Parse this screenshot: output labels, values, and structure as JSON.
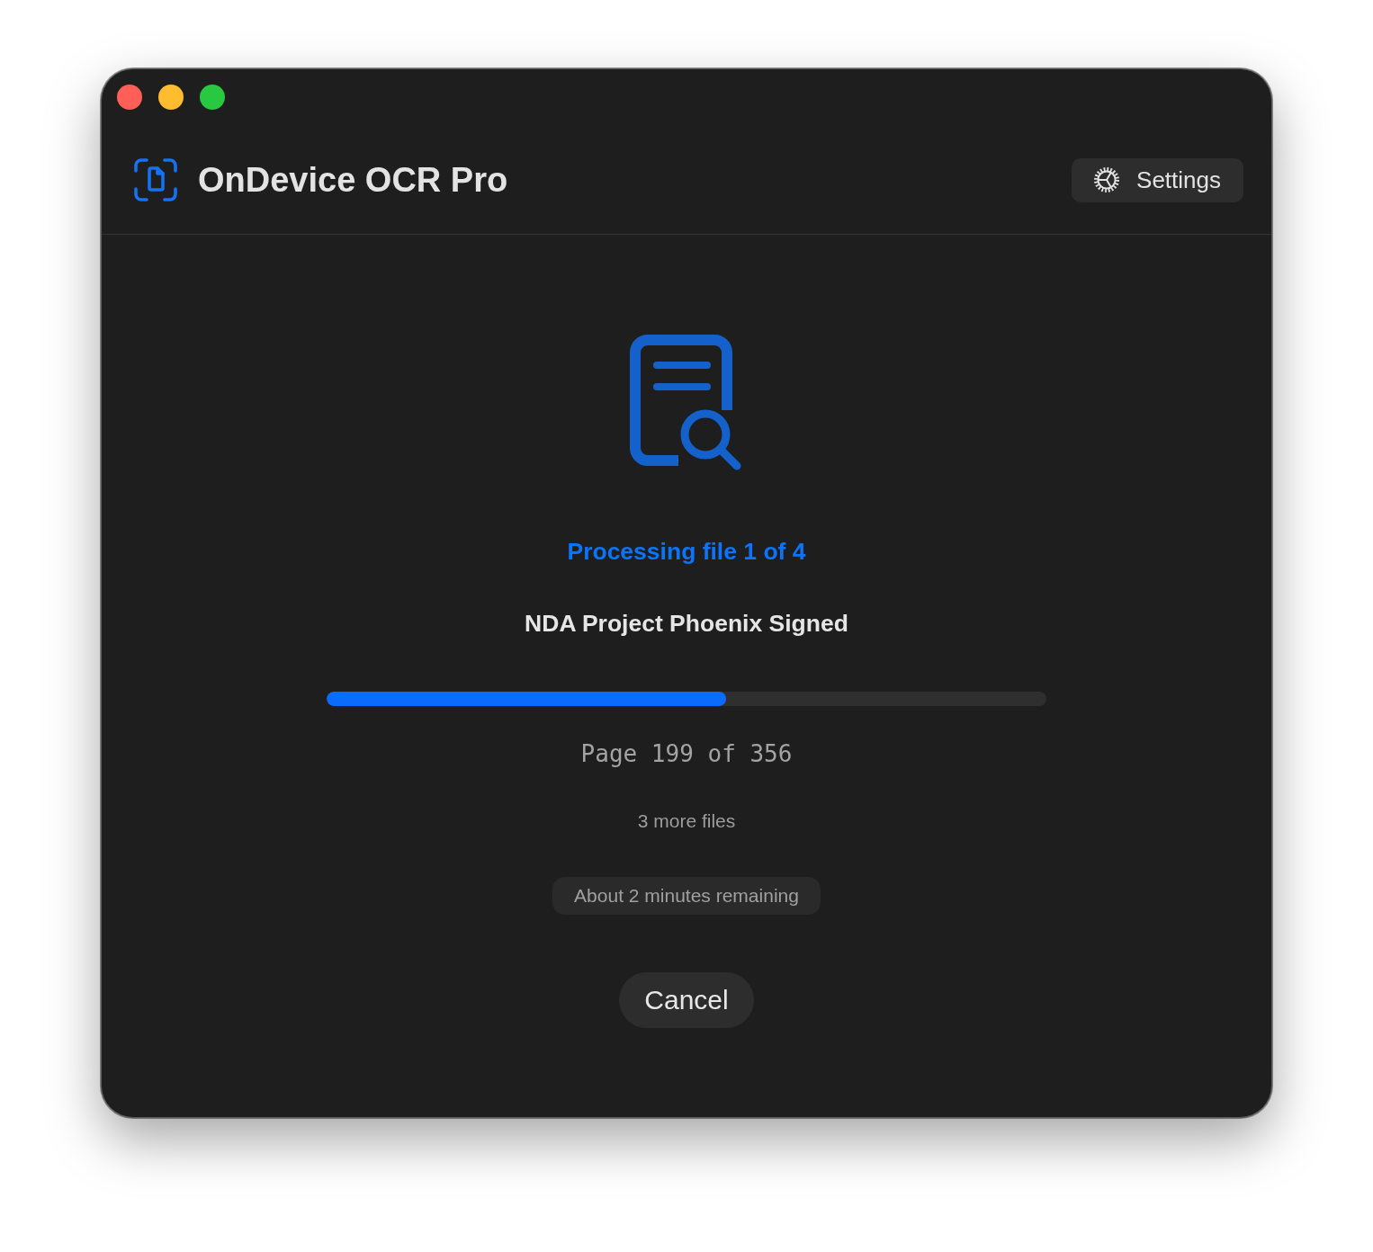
{
  "window": {
    "controls": [
      {
        "color": "#ff5f57"
      },
      {
        "color": "#febc2e"
      },
      {
        "color": "#28c840"
      }
    ]
  },
  "header": {
    "title": "OnDevice OCR Pro",
    "settings_button": {
      "label": "Settings"
    }
  },
  "status": {
    "heading": "Processing file 1 of 4",
    "file_name": "NDA Project Phoenix Signed",
    "progress": {
      "level": 0.555
    },
    "page_text": "Page 199 of 356",
    "remaining_files": "3 more files",
    "time_remaining": "About 2 minutes remaining"
  },
  "cancel_button": {
    "label": "Cancel"
  }
}
